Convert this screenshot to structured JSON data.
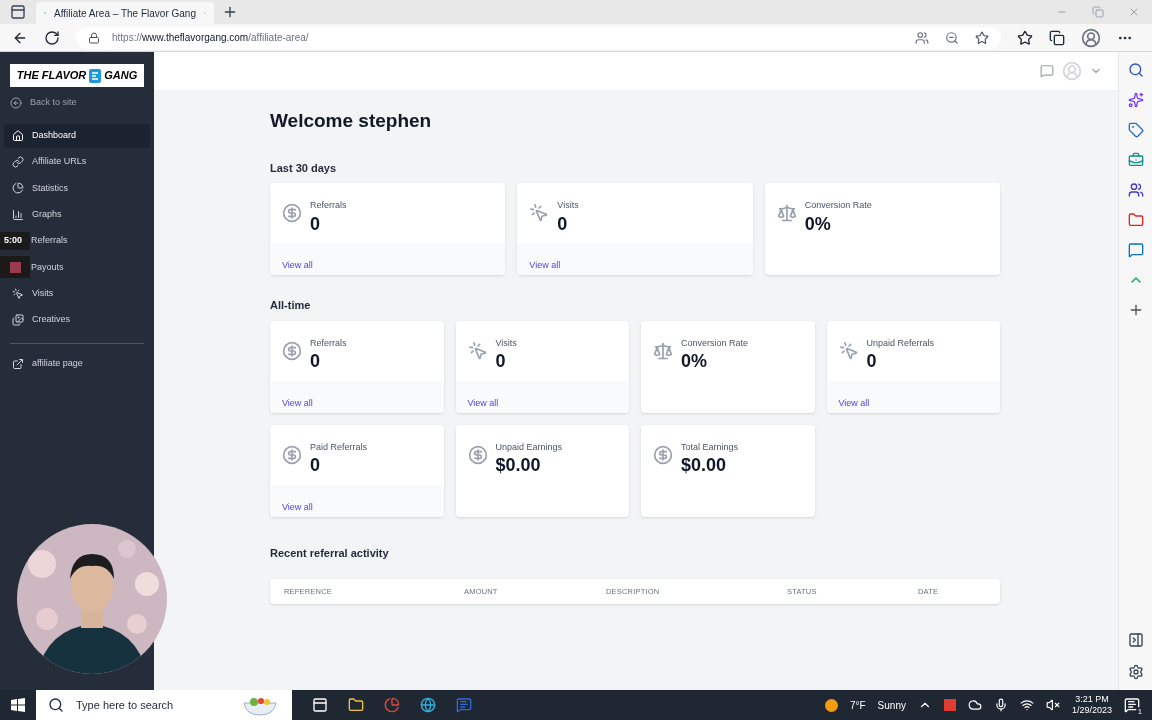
{
  "browser": {
    "tab_title": "Affiliate Area – The Flavor Gang",
    "url_prefix": "https://",
    "url_host": "www.theflavorgang.com",
    "url_path": "/affiliate-area/"
  },
  "logo": {
    "left": "THE FLAVOR",
    "right": "GANG"
  },
  "back_link": "Back to site",
  "sidebar": {
    "items": [
      {
        "label": "Dashboard",
        "selected": true
      },
      {
        "label": "Affiliate URLs",
        "selected": false
      },
      {
        "label": "Statistics",
        "selected": false
      },
      {
        "label": "Graphs",
        "selected": false
      },
      {
        "label": "Referrals",
        "selected": false
      },
      {
        "label": "Payouts",
        "selected": false
      },
      {
        "label": "Visits",
        "selected": false
      },
      {
        "label": "Creatives",
        "selected": false
      }
    ],
    "external_link": "affiliate page"
  },
  "recorder": {
    "timer": "5:00"
  },
  "welcome": "Welcome stephen",
  "sections": [
    {
      "title": "Last 30 days",
      "cards": [
        {
          "kind": "money",
          "label": "Referrals",
          "value": "0",
          "link": "View all"
        },
        {
          "kind": "click",
          "label": "Visits",
          "value": "0",
          "link": "View all"
        },
        {
          "kind": "ratio",
          "label": "Conversion Rate",
          "value": "0%"
        }
      ]
    },
    {
      "title": "All-time",
      "cards": [
        {
          "kind": "money",
          "label": "Referrals",
          "value": "0",
          "link": "View all"
        },
        {
          "kind": "click",
          "label": "Visits",
          "value": "0",
          "link": "View all"
        },
        {
          "kind": "ratio",
          "label": "Conversion Rate",
          "value": "0%"
        },
        {
          "kind": "click",
          "label": "Unpaid Referrals",
          "value": "0",
          "link": "View all"
        },
        {
          "kind": "money",
          "label": "Paid Referrals",
          "value": "0",
          "link": "View all"
        },
        {
          "kind": "money",
          "label": "Unpaid Earnings",
          "value": "$0.00"
        },
        {
          "kind": "money",
          "label": "Total Earnings",
          "value": "$0.00"
        }
      ]
    }
  ],
  "activity": {
    "title": "Recent referral activity",
    "columns": [
      "REFERENCE",
      "AMOUNT",
      "DESCRIPTION",
      "STATUS",
      "DATE"
    ]
  },
  "taskbar": {
    "search_placeholder": "Type here to search",
    "temperature": "7°F",
    "weather": "Sunny",
    "time": "3:21 PM",
    "date": "1/29/2023",
    "notifications": "1"
  }
}
